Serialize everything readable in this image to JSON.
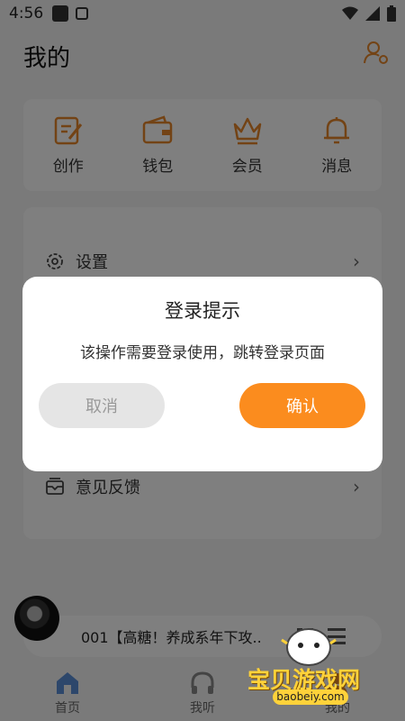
{
  "status_bar": {
    "time": "4:56"
  },
  "header": {
    "title": "我的"
  },
  "quick_actions": [
    {
      "label": "创作",
      "icon": "edit-icon"
    },
    {
      "label": "钱包",
      "icon": "wallet-icon"
    },
    {
      "label": "会员",
      "icon": "crown-icon"
    },
    {
      "label": "消息",
      "icon": "bell-icon"
    }
  ],
  "menu": {
    "settings_label": "设置",
    "feedback_label": "意见反馈"
  },
  "player": {
    "track": "001【高糖！养成系年下攻.."
  },
  "tabs": [
    {
      "label": "首页"
    },
    {
      "label": "我听"
    },
    {
      "label": "我的"
    }
  ],
  "dialog": {
    "title": "登录提示",
    "message": "该操作需要登录使用，跳转登录页面",
    "cancel_label": "取消",
    "confirm_label": "确认"
  },
  "watermark": {
    "text": "宝贝游戏网",
    "url": "baobeiy.com"
  },
  "colors": {
    "accent": "#fb8c1e",
    "icon_orange": "#e6872b"
  }
}
